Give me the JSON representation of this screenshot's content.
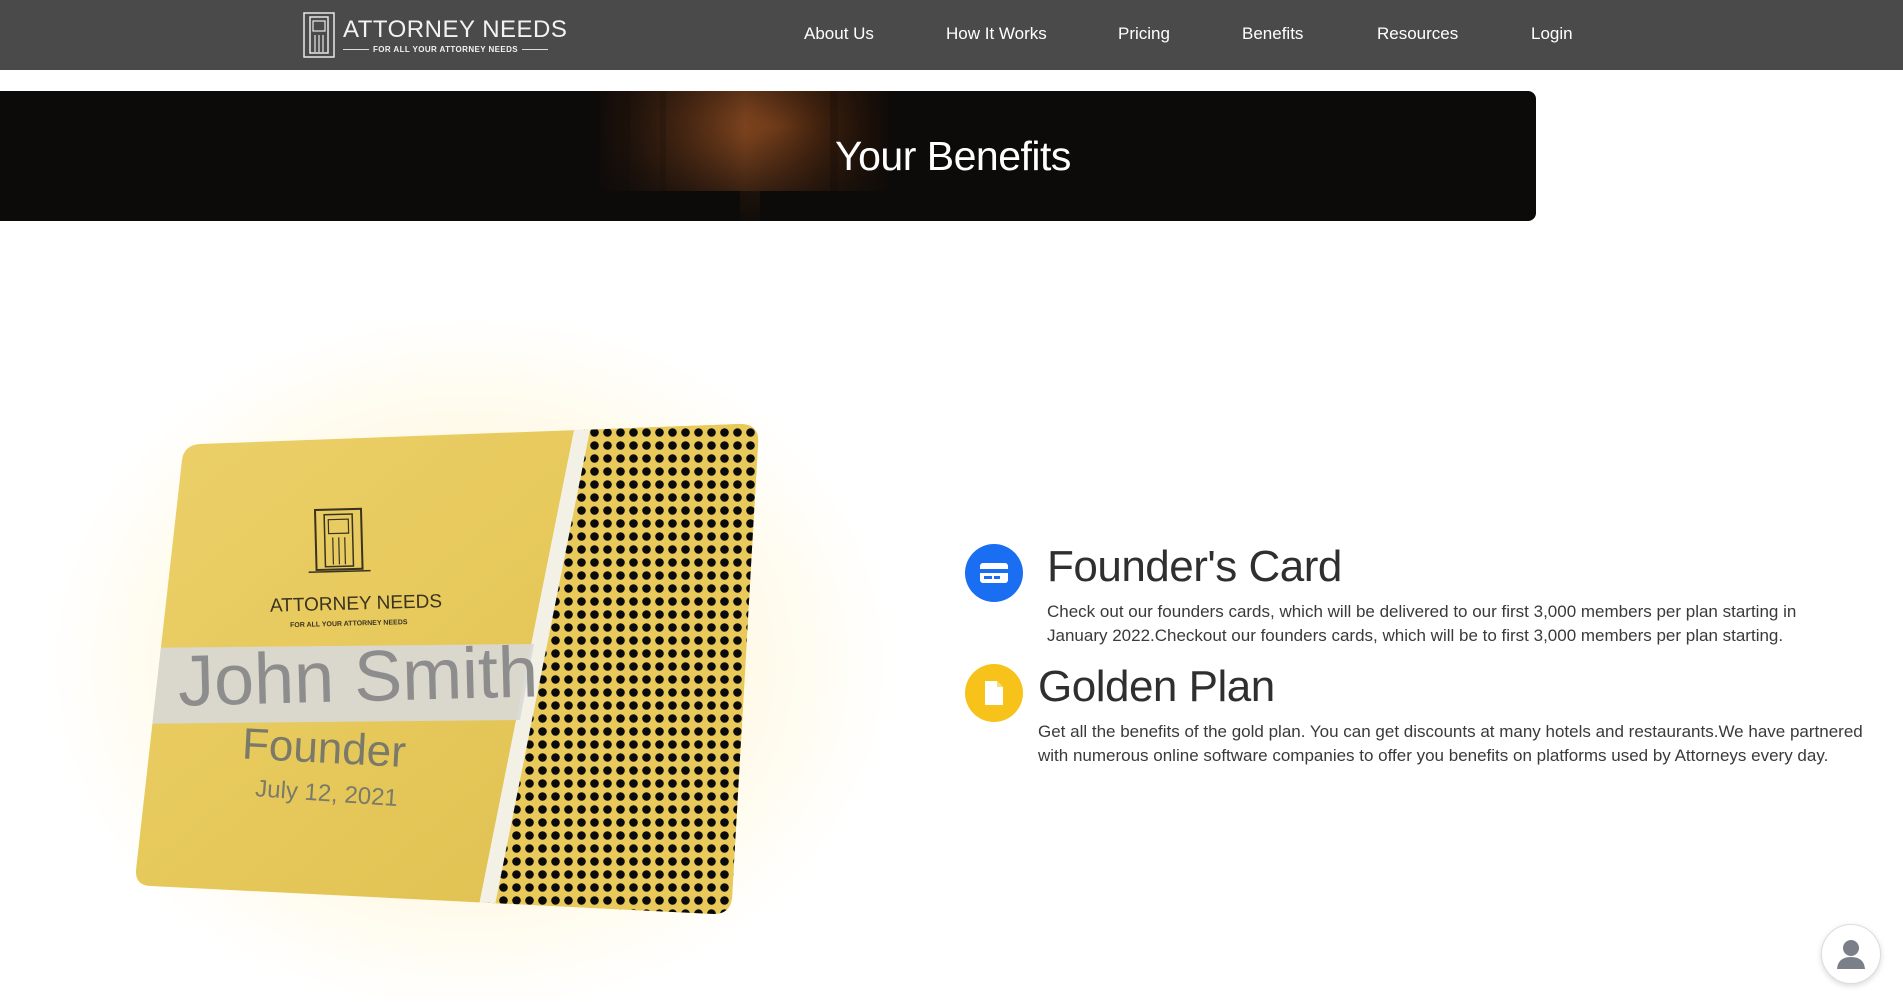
{
  "brand": {
    "title": "ATTORNEY NEEDS",
    "tagline": "FOR ALL YOUR ATTORNEY NEEDS",
    "icon": "door-logo-icon"
  },
  "nav": {
    "items": [
      {
        "label": "About Us"
      },
      {
        "label": "How It Works"
      },
      {
        "label": "Pricing"
      },
      {
        "label": "Benefits"
      },
      {
        "label": "Resources"
      },
      {
        "label": "Login"
      }
    ]
  },
  "banner": {
    "title": "Your Benefits"
  },
  "card": {
    "brand": "ATTORNEY NEEDS",
    "tagline": "FOR ALL YOUR ATTORNEY NEEDS",
    "name": "John Smith",
    "role": "Founder",
    "date": "July 12, 2021"
  },
  "features": [
    {
      "icon": "credit-card-icon",
      "icon_color": "#1a6ef2",
      "title": "Founder's Card",
      "description": "Check out our founders cards, which will be delivered to our first 3,000 members per plan starting in January 2022.Checkout our founders cards, which will be to first 3,000 members per plan starting."
    },
    {
      "icon": "document-icon",
      "icon_color": "#f7c31a",
      "title": "Golden Plan",
      "description": "Get all the benefits of the gold plan. You can get discounts at many hotels and restaurants.We have partnered with numerous online software companies to offer you benefits on platforms used by Attorneys every day."
    }
  ],
  "chat": {
    "icon": "user-avatar-icon"
  },
  "colors": {
    "navbar": "#4a4a4a",
    "banner": "#0d0b0a",
    "gold": "#e8c95a",
    "accent_blue": "#1a6ef2",
    "accent_yellow": "#f7c31a"
  }
}
